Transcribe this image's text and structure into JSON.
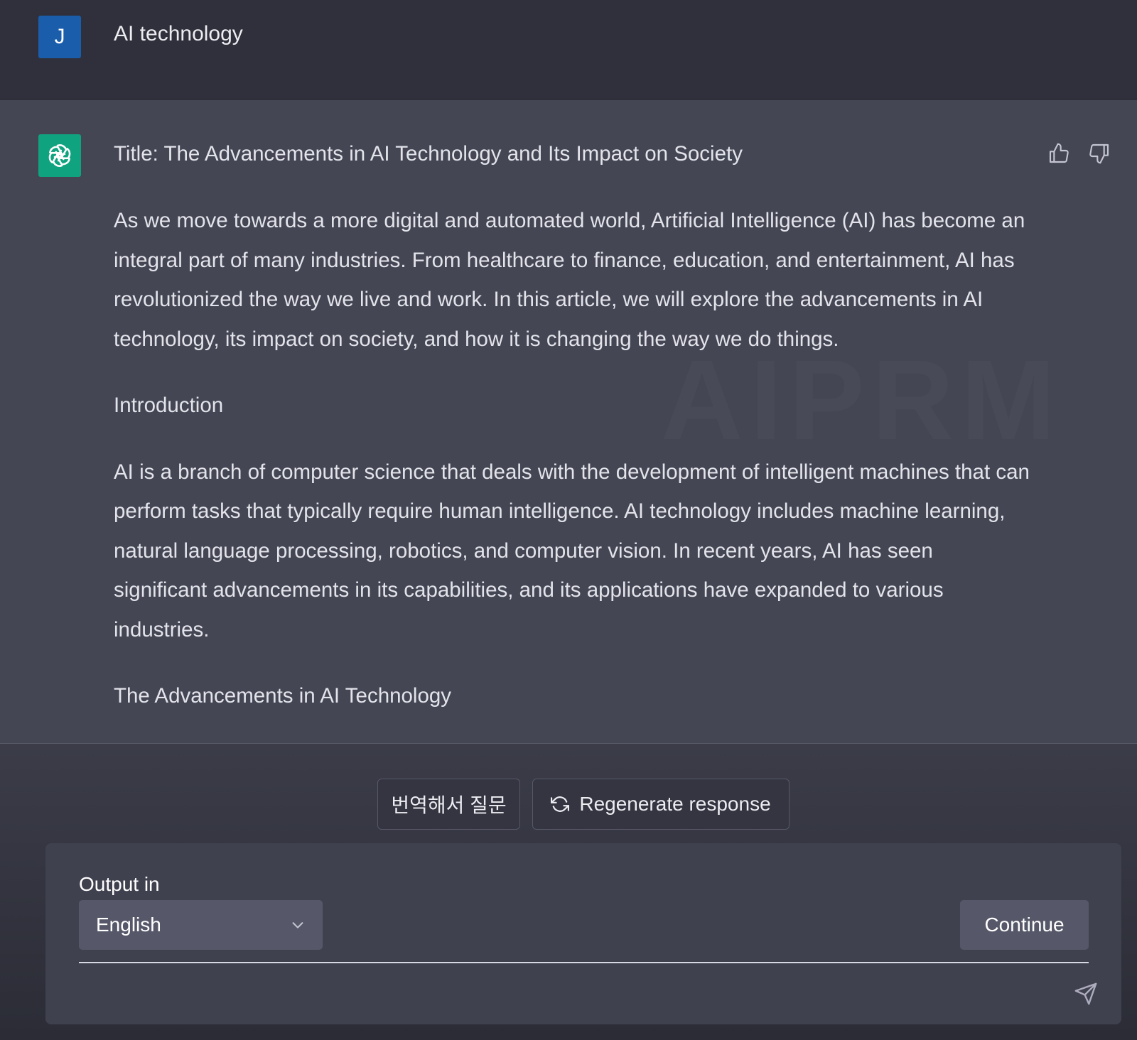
{
  "user": {
    "avatar_letter": "J",
    "message": "AI technology"
  },
  "assistant": {
    "title_line": "Title: The Advancements in AI Technology and Its Impact on Society",
    "paragraphs": [
      "As we move towards a more digital and automated world, Artificial Intelligence (AI) has become an integral part of many industries. From healthcare to finance, education, and entertainment, AI has revolutionized the way we live and work. In this article, we will explore the advancements in AI technology, its impact on society, and how it is changing the way we do things.",
      "Introduction",
      "AI is a branch of computer science that deals with the development of intelligent machines that can perform tasks that typically require human intelligence. AI technology includes machine learning, natural language processing, robotics, and computer vision. In recent years, AI has seen significant advancements in its capabilities, and its applications have expanded to various industries.",
      "The Advancements in AI Technology"
    ],
    "icons": {
      "avatar": "openai-logo-icon",
      "like": "thumbs-up-icon",
      "dislike": "thumbs-down-icon"
    }
  },
  "actions": {
    "translate_label": "번역해서 질문",
    "regenerate_label": "Regenerate response",
    "regenerate_icon": "refresh-icon"
  },
  "composer": {
    "output_label": "Output in",
    "language_selected": "English",
    "continue_label": "Continue",
    "prompt_value": "",
    "send_icon": "send-icon"
  },
  "colors": {
    "user_avatar": "#1a5dab",
    "assistant_avatar": "#10a37f",
    "background": "#343541",
    "assistant_background": "#444654"
  }
}
